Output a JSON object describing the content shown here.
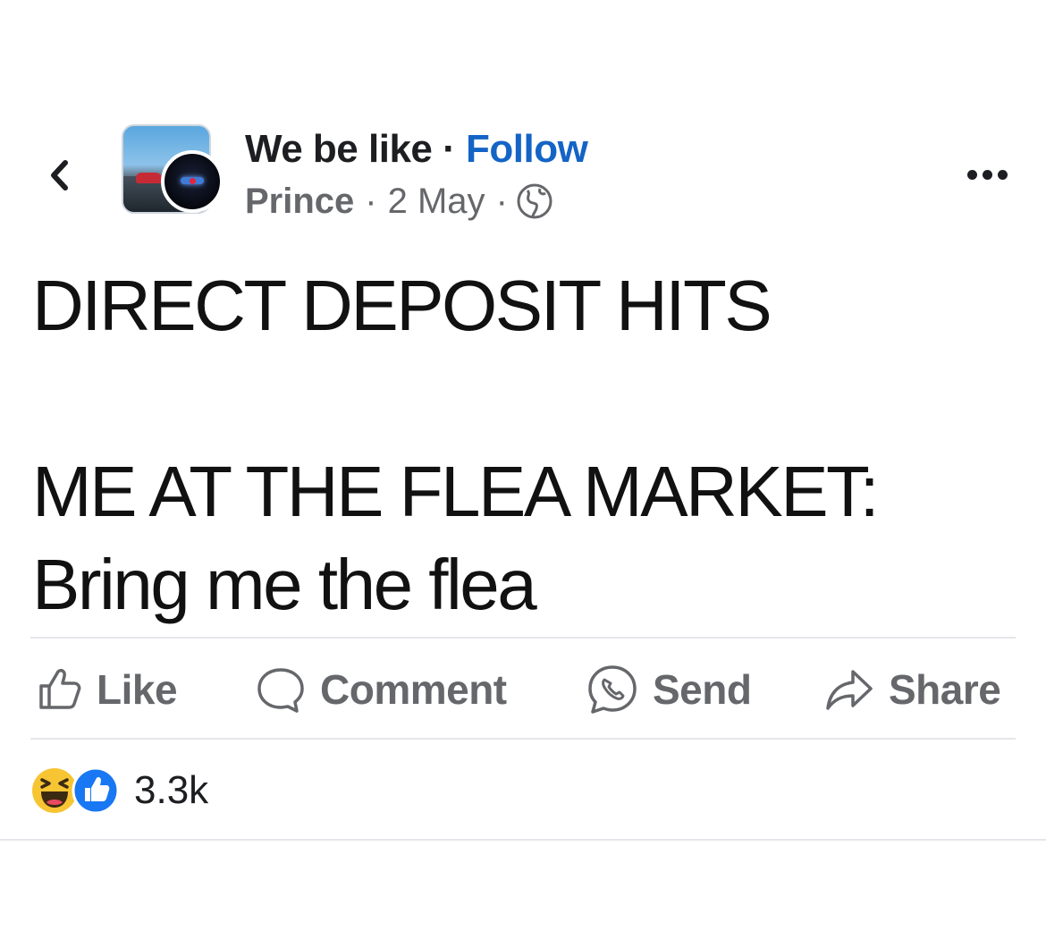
{
  "header": {
    "back_icon": "chevron-left-icon",
    "page_name": "We be like",
    "separator": "·",
    "follow_label": "Follow",
    "author": "Prince",
    "date": "2 May",
    "privacy_icon": "globe-icon",
    "more_icon": "more-options-icon"
  },
  "post": {
    "line1": "DIRECT DEPOSIT HITS",
    "line2": "ME AT THE FLEA MARKET:",
    "line3": "Bring me the flea"
  },
  "actions": [
    {
      "label": "Like",
      "icon": "thumbs-up-icon"
    },
    {
      "label": "Comment",
      "icon": "comment-icon"
    },
    {
      "label": "Send",
      "icon": "messenger-icon"
    },
    {
      "label": "Share",
      "icon": "share-arrow-icon"
    }
  ],
  "reactions": {
    "icons": [
      "haha-emoji-icon",
      "like-reaction-icon"
    ],
    "count": "3.3k"
  },
  "colors": {
    "follow": "#1464c6",
    "secondary_text": "#65676b",
    "like_blue": "#1877f2",
    "haha_yellow": "#f7c433"
  }
}
